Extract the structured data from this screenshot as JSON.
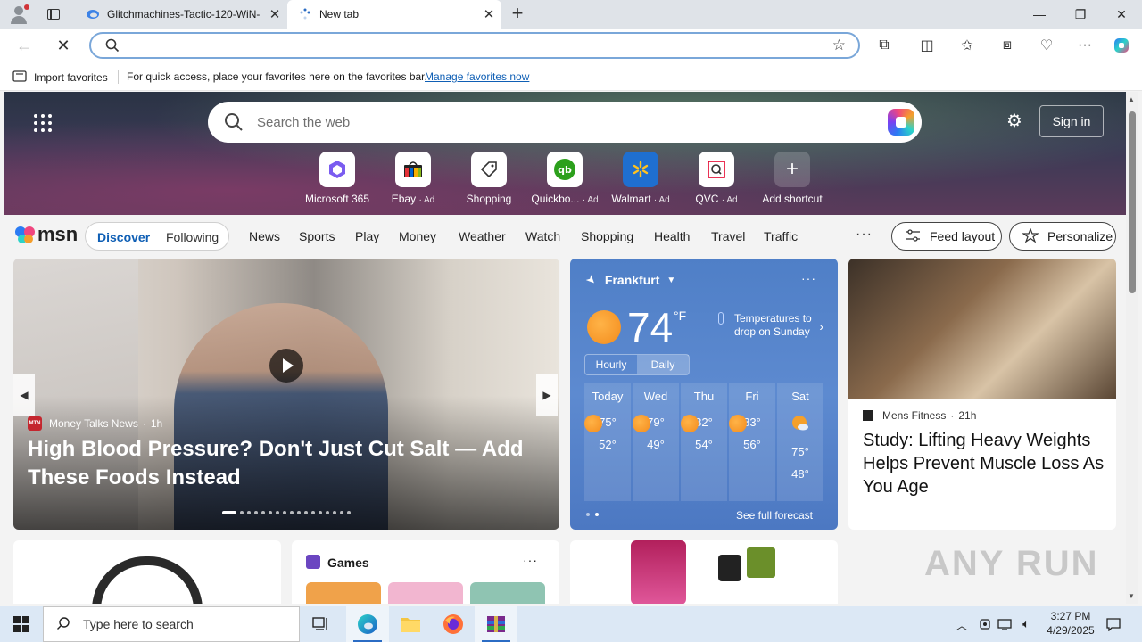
{
  "browser": {
    "tabs": [
      {
        "label": "Glitchmachines-Tactic-120-WiN-"
      },
      {
        "label": "New tab"
      }
    ],
    "address_value": "",
    "favorites_bar": {
      "import_label": "Import favorites",
      "message": "For quick access, place your favorites here on the favorites bar.",
      "link": "Manage favorites now"
    }
  },
  "ntp": {
    "search_placeholder": "Search the web",
    "sign_in": "Sign in",
    "shortcuts": [
      {
        "label": "Microsoft 365",
        "ad": ""
      },
      {
        "label": "Ebay",
        "ad": "· Ad"
      },
      {
        "label": "Shopping",
        "ad": ""
      },
      {
        "label": "Quickbo...",
        "ad": "· Ad"
      },
      {
        "label": "Walmart",
        "ad": "· Ad"
      },
      {
        "label": "QVC",
        "ad": "· Ad"
      },
      {
        "label": "Add shortcut",
        "ad": ""
      }
    ]
  },
  "msn": {
    "logo": "msn",
    "discover": "Discover",
    "following": "Following",
    "nav": [
      "News",
      "Sports",
      "Play",
      "Money",
      "Weather",
      "Watch",
      "Shopping",
      "Health",
      "Travel",
      "Traffic"
    ],
    "more": "···",
    "feed_layout": "Feed layout",
    "personalize": "Personalize"
  },
  "main_story": {
    "source": "Money Talks News",
    "age": "1h",
    "headline": "High Blood Pressure? Don't Just Cut Salt — Add These Foods Instead"
  },
  "weather": {
    "location": "Frankfurt",
    "temp": "74",
    "unit": "°F",
    "note": "Temperatures to drop on Sunday",
    "modes": [
      "Hourly",
      "Daily"
    ],
    "days": [
      {
        "name": "Today",
        "hi": "75°",
        "lo": "52°"
      },
      {
        "name": "Wed",
        "hi": "79°",
        "lo": "49°"
      },
      {
        "name": "Thu",
        "hi": "82°",
        "lo": "54°"
      },
      {
        "name": "Fri",
        "hi": "83°",
        "lo": "56°"
      },
      {
        "name": "Sat",
        "hi": "75°",
        "lo": "48°"
      }
    ],
    "full_forecast": "See full forecast"
  },
  "fitness_story": {
    "source": "Mens Fitness",
    "age": "21h",
    "headline": "Study: Lifting Heavy Weights Helps Prevent Muscle Loss As You Age"
  },
  "games": {
    "title": "Games"
  },
  "taskbar": {
    "search_placeholder": "Type here to search",
    "time": "3:27 PM",
    "date": "4/29/2025"
  },
  "watermark": "ANY RUN"
}
